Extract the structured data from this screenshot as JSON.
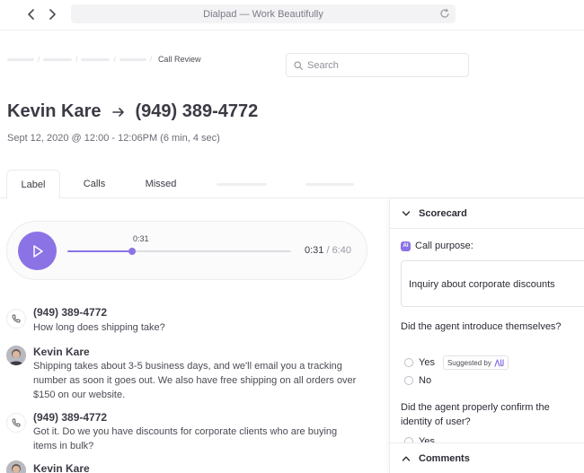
{
  "browser": {
    "title": "Dialpad — Work Beautifully"
  },
  "breadcrumb": {
    "current": "Call Review"
  },
  "search": {
    "placeholder": "Search",
    "value": ""
  },
  "call": {
    "from_name": "Kevin Kare",
    "to_number": "(949) 389-4772",
    "datetime": "Sept 12, 2020 @ 12:00 - 12:06PM (6 min, 4 sec)"
  },
  "tabs": [
    {
      "label": "Label",
      "active": true
    },
    {
      "label": "Calls",
      "active": false
    },
    {
      "label": "Missed",
      "active": false
    }
  ],
  "player": {
    "position_label": "0:31",
    "current": "0:31",
    "separator": " / ",
    "total": "6:40",
    "progress": 0.29
  },
  "transcript": [
    {
      "speaker": "(949) 389-4772",
      "kind": "phone",
      "text": "How long does shipping take?"
    },
    {
      "speaker": "Kevin Kare",
      "kind": "agent",
      "text": "Shipping takes about 3-5 business days, and we'll email you a tracking number as soon it goes out. We also have free shipping on all orders over $150 on our website."
    },
    {
      "speaker": "(949) 389-4772",
      "kind": "phone",
      "text": "Got it. Do we you have discounts for corporate clients who are buying items in bulk?"
    },
    {
      "speaker": "Kevin Kare",
      "kind": "agent",
      "text": ""
    }
  ],
  "scorecard": {
    "header": "Scorecard",
    "call_purpose_label": "Call purpose:",
    "ai_badge": "AI",
    "call_purpose_value": "Inquiry about corporate discounts",
    "q1": "Did the agent introduce themselves?",
    "q1_yes": "Yes",
    "q1_suggested": "Suggested by",
    "q1_no": "No",
    "q2": "Did the agent properly confirm the identity of user?",
    "q2_yes": "Yes",
    "footer": "Comments"
  },
  "colors": {
    "accent": "#8b73e6",
    "text": "#2b2b35",
    "muted": "#6c6c76"
  }
}
